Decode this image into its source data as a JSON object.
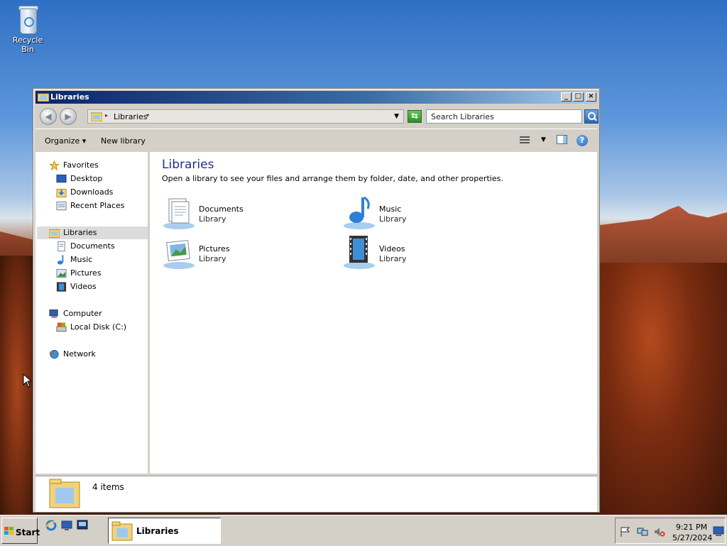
{
  "desktop": {
    "recycle_bin_label": "Recycle Bin"
  },
  "window": {
    "title": "Libraries",
    "address": {
      "path": "Libraries"
    },
    "search": {
      "placeholder": "Search Libraries"
    },
    "toolbar": {
      "organize_label": "Organize",
      "new_library_label": "New library"
    },
    "nav": {
      "favorites": "Favorites",
      "desktop": "Desktop",
      "downloads": "Downloads",
      "recent_places": "Recent Places",
      "libraries": "Libraries",
      "documents": "Documents",
      "music": "Music",
      "pictures": "Pictures",
      "videos": "Videos",
      "computer": "Computer",
      "local_disk": "Local Disk (C:)",
      "network": "Network"
    },
    "main": {
      "title": "Libraries",
      "description": "Open a library to see your files and arrange them by folder, date, and other properties.",
      "items": [
        {
          "name": "Documents",
          "type": "Library",
          "icon": "documents-library-icon"
        },
        {
          "name": "Music",
          "type": "Library",
          "icon": "music-library-icon"
        },
        {
          "name": "Pictures",
          "type": "Library",
          "icon": "pictures-library-icon"
        },
        {
          "name": "Videos",
          "type": "Library",
          "icon": "videos-library-icon"
        }
      ]
    },
    "details": {
      "count_text": "4 items"
    }
  },
  "taskbar": {
    "start_label": "Start",
    "active_task": "Libraries",
    "clock": {
      "time": "9:21 PM",
      "date": "5/27/2024"
    }
  },
  "colors": {
    "title_gradient_start": "#0a246a",
    "title_gradient_end": "#a6caf0",
    "heading_blue": "#1e3287",
    "chrome_gray": "#d4d0c8"
  }
}
